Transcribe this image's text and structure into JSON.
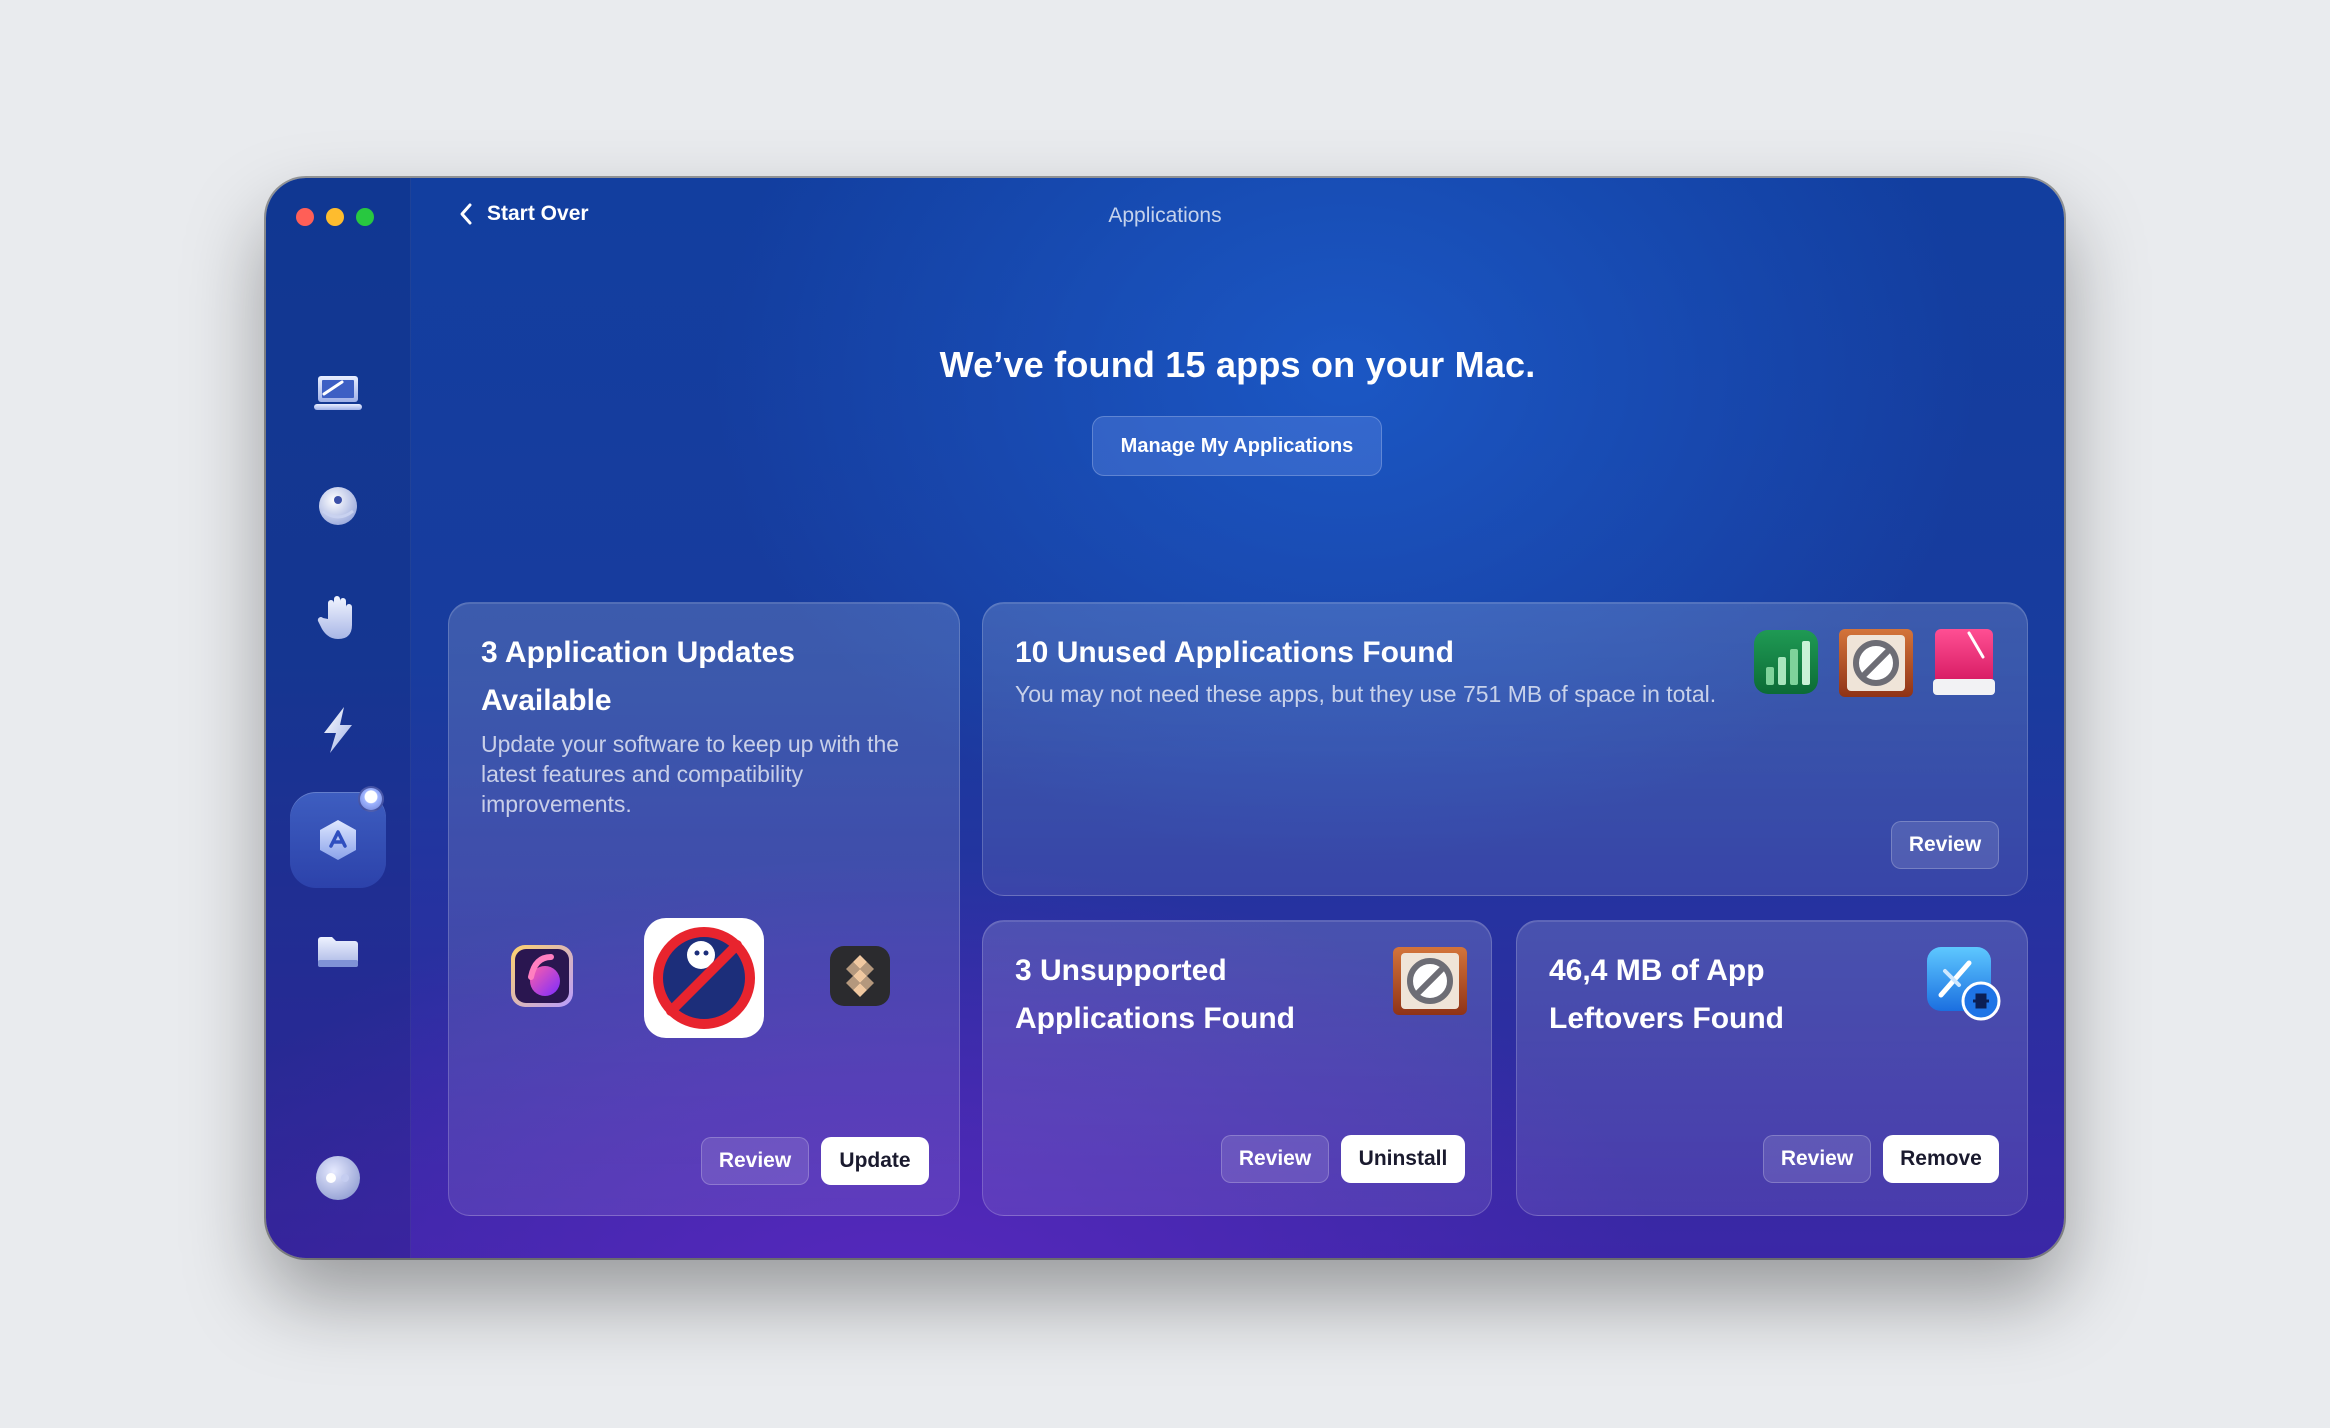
{
  "window": {
    "title": "Applications",
    "back_label": "Start Over"
  },
  "sidebar": {
    "items": [
      {
        "name": "smart-care",
        "icon": "laptop-sweep-icon"
      },
      {
        "name": "cleanup",
        "icon": "bubble-icon"
      },
      {
        "name": "protection",
        "icon": "hand-icon"
      },
      {
        "name": "performance",
        "icon": "lightning-icon"
      },
      {
        "name": "applications",
        "icon": "app-store-icon",
        "active": true
      },
      {
        "name": "my-clutter",
        "icon": "folder-icon"
      }
    ],
    "bottom_icon": "assistant-icon"
  },
  "main": {
    "headline": "We’ve found 15 apps on your Mac.",
    "manage_label": "Manage My Applications"
  },
  "cards": {
    "updates": {
      "title": "3 Application Updates Available",
      "description": "Update your software to keep up with the latest features and compatibility improvements.",
      "review_label": "Review",
      "action_label": "Update"
    },
    "unused": {
      "title": "10 Unused Applications Found",
      "description": "You may not need these apps, but they use 751 MB of space in total.",
      "review_label": "Review"
    },
    "unsupported": {
      "title": "3 Unsupported Applications Found",
      "review_label": "Review",
      "action_label": "Uninstall"
    },
    "leftovers": {
      "title": "46,4 MB of App Leftovers Found",
      "review_label": "Review",
      "action_label": "Remove"
    }
  },
  "colors": {
    "close": "#ff5f57",
    "minimize": "#febc2e",
    "zoom": "#28c840"
  }
}
